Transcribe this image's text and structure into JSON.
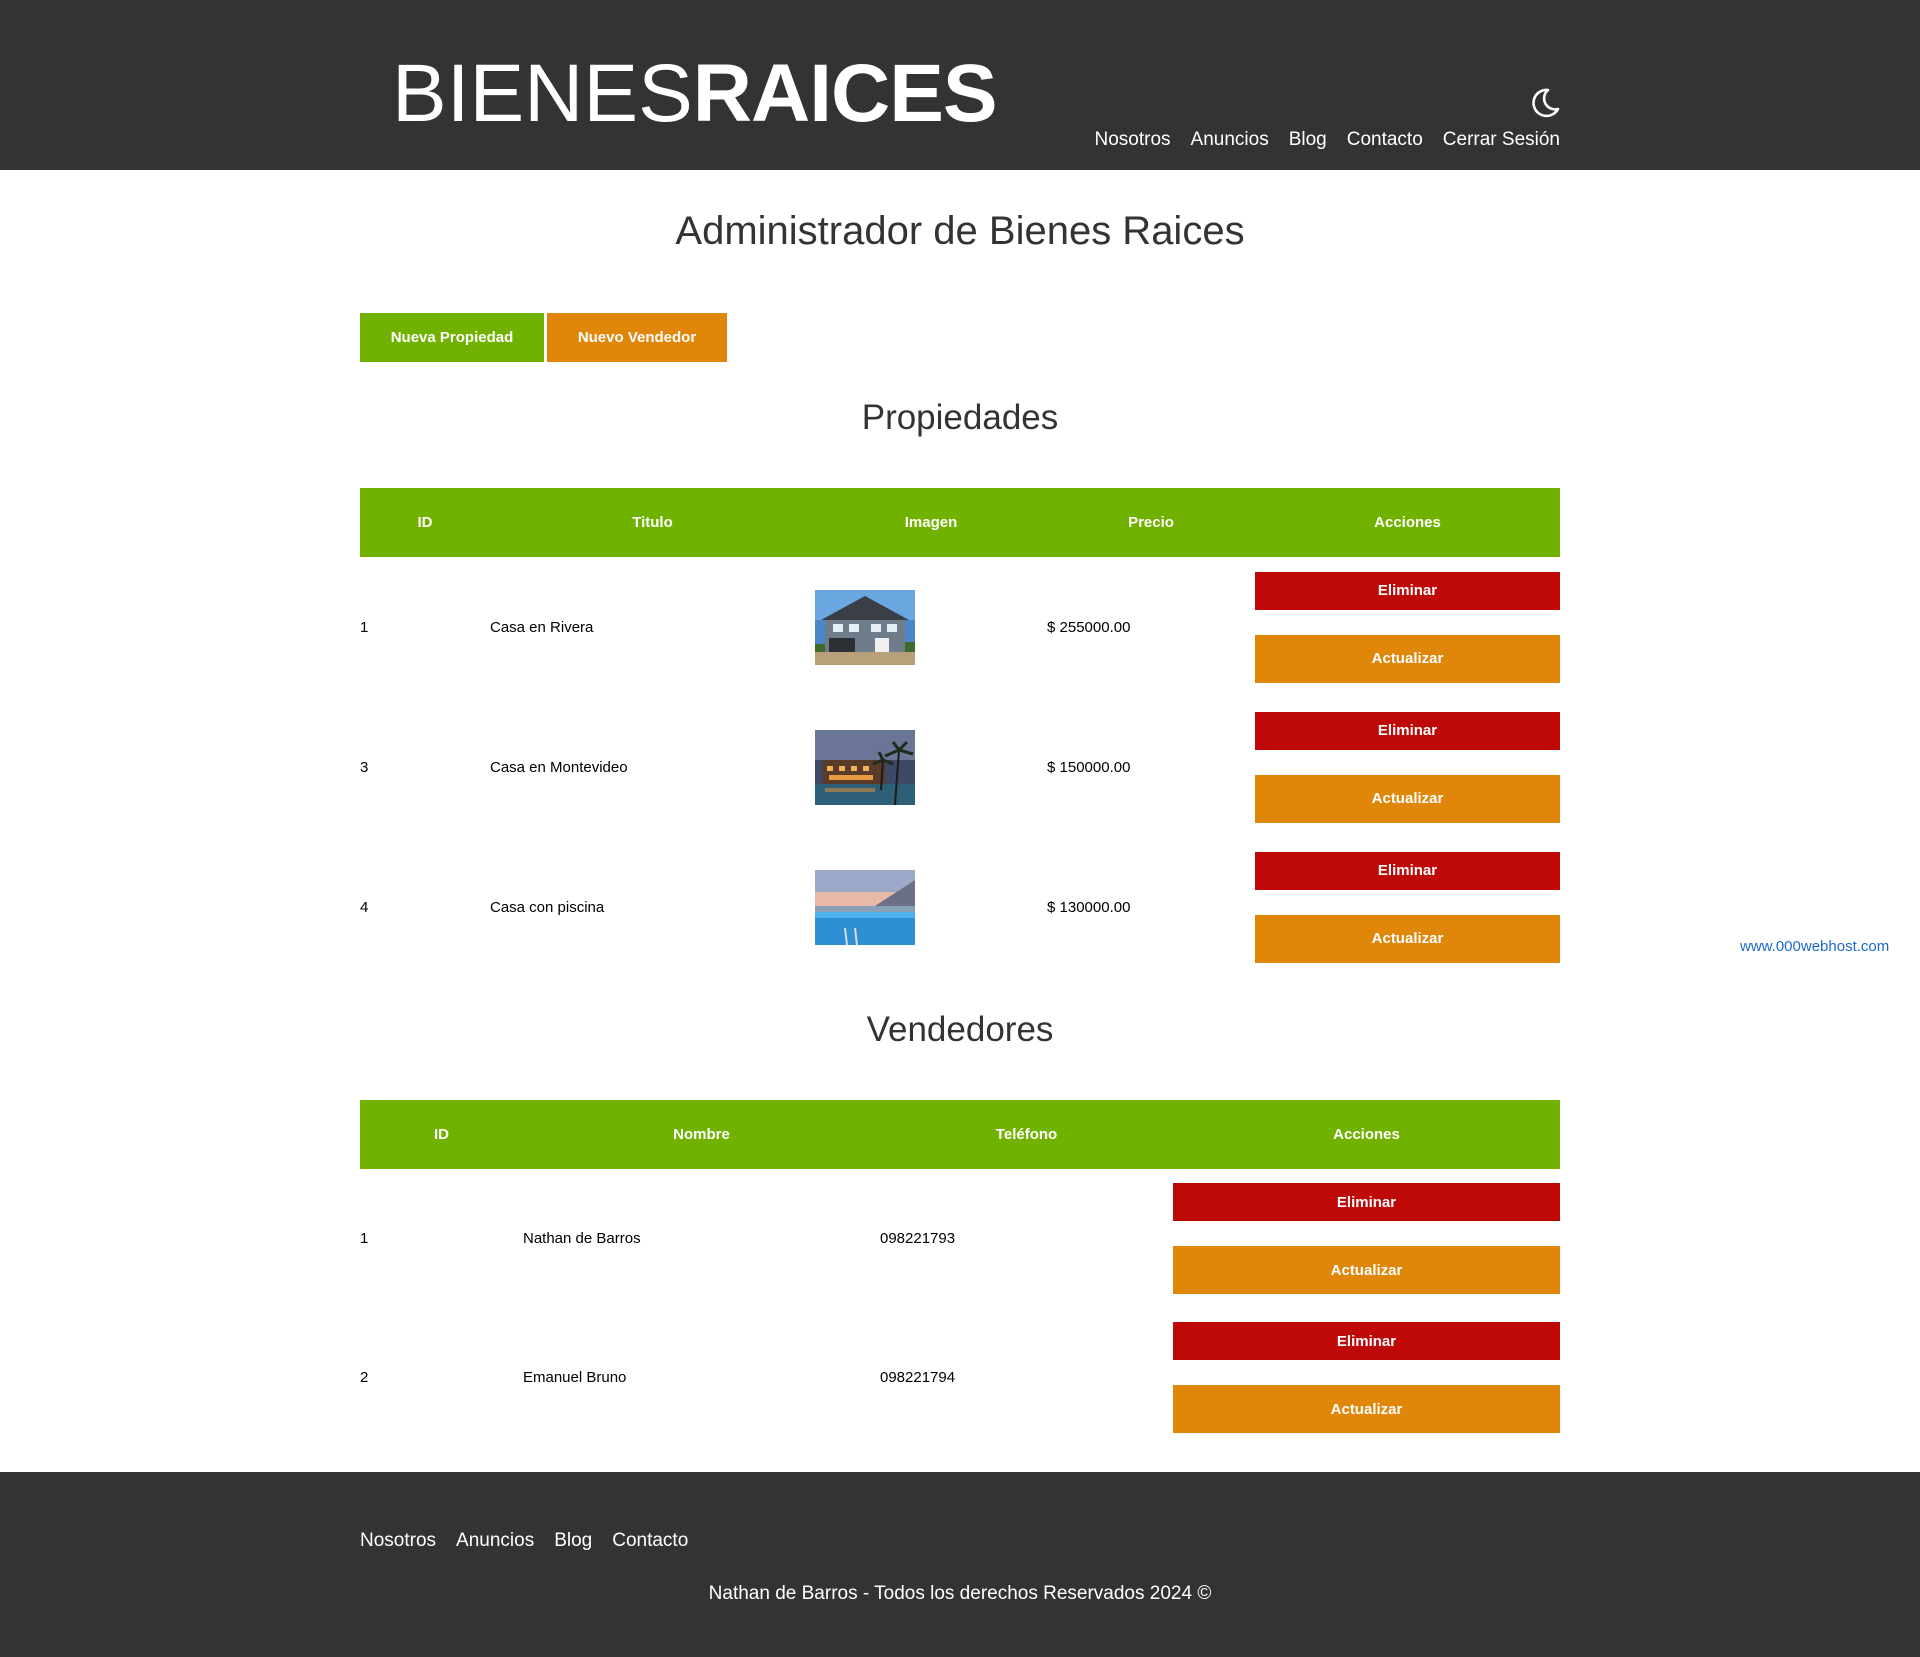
{
  "header": {
    "logo_light": "BIENES",
    "logo_bold": "RAICES",
    "dark_mode_icon": "moon-icon",
    "nav": [
      "Nosotros",
      "Anuncios",
      "Blog",
      "Contacto",
      "Cerrar Sesión"
    ]
  },
  "main": {
    "title": "Administrador de Bienes Raices",
    "buttons": {
      "new_property": "Nueva Propiedad",
      "new_seller": "Nuevo Vendedor"
    },
    "properties": {
      "title": "Propiedades",
      "headers": [
        "ID",
        "Titulo",
        "Imagen",
        "Precio",
        "Acciones"
      ],
      "rows": [
        {
          "id": "1",
          "title": "Casa en Rivera",
          "image": "house-photo",
          "price": "$ 255000.00",
          "delete": "Eliminar",
          "update": "Actualizar"
        },
        {
          "id": "3",
          "title": "Casa en Montevideo",
          "image": "resort-photo",
          "price": "$ 150000.00",
          "delete": "Eliminar",
          "update": "Actualizar"
        },
        {
          "id": "4",
          "title": "Casa con piscina",
          "image": "pool-photo",
          "price": "$ 130000.00",
          "delete": "Eliminar",
          "update": "Actualizar"
        }
      ]
    },
    "sellers": {
      "title": "Vendedores",
      "headers": [
        "ID",
        "Nombre",
        "Teléfono",
        "Acciones"
      ],
      "rows": [
        {
          "id": "1",
          "name": "Nathan de Barros",
          "phone": "098221793",
          "delete": "Eliminar",
          "update": "Actualizar"
        },
        {
          "id": "2",
          "name": "Emanuel Bruno",
          "phone": "098221794",
          "delete": "Eliminar",
          "update": "Actualizar"
        }
      ]
    }
  },
  "host_link": "www.000webhost.com",
  "footer": {
    "nav": [
      "Nosotros",
      "Anuncios",
      "Blog",
      "Contacto"
    ],
    "copyright": "Nathan de Barros - Todos los derechos Reservados 2024 ©"
  },
  "colors": {
    "header_bg": "#333333",
    "primary_green": "#71b100",
    "orange": "#e08709",
    "red": "#bf0909",
    "link_blue": "#1a6acb"
  }
}
